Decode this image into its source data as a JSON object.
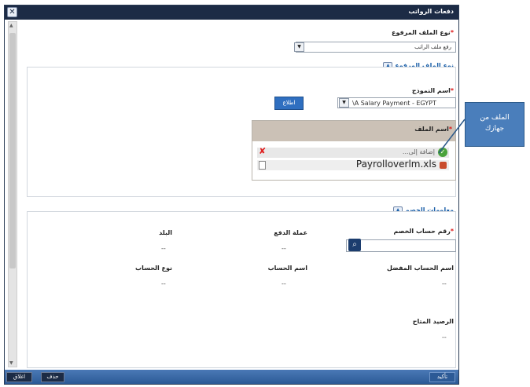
{
  "dialog": {
    "title": "دفعات الرواتب",
    "close_icon": "close-icon"
  },
  "upload_type": {
    "label": "نوع الملف المرفوع",
    "value": "رفع ملف الراتب"
  },
  "upload_section": {
    "header": "نوع الملف المرفوع",
    "template_label": "اسم النموذج",
    "template_value": "\\A Salary Payment - EGYPT",
    "template_button": "اطلاع",
    "file_name_label": "اسم الملف",
    "add_placeholder": "إضافة إلى...",
    "file_name": "Payrolloverlm.xls"
  },
  "debit_section": {
    "header": "معلومات الخصم",
    "account_number_label": "رقم حساب الخصم",
    "payment_currency_label": "عملة الدفع",
    "payment_currency_value": "--",
    "country_label": "البلد",
    "country_value": "--",
    "preferred_account_label": "اسم الحساب المفضل",
    "preferred_account_value": "--",
    "account_name_label": "اسم الحساب",
    "account_name_value": "--",
    "account_type_label": "نوع الحساب",
    "account_type_value": "--",
    "available_balance_label": "الرصيد المتاح",
    "available_balance_value": "--"
  },
  "footer": {
    "confirm": "تأكيد",
    "delete": "حذف",
    "close": "اغلاق"
  },
  "callout": {
    "line1": "الملف من",
    "line2": "جهازك"
  },
  "colors": {
    "titlebar": "#1c2b45",
    "accent": "#2c5a96",
    "callout": "#4a7ebb",
    "required": "#dd1111"
  }
}
